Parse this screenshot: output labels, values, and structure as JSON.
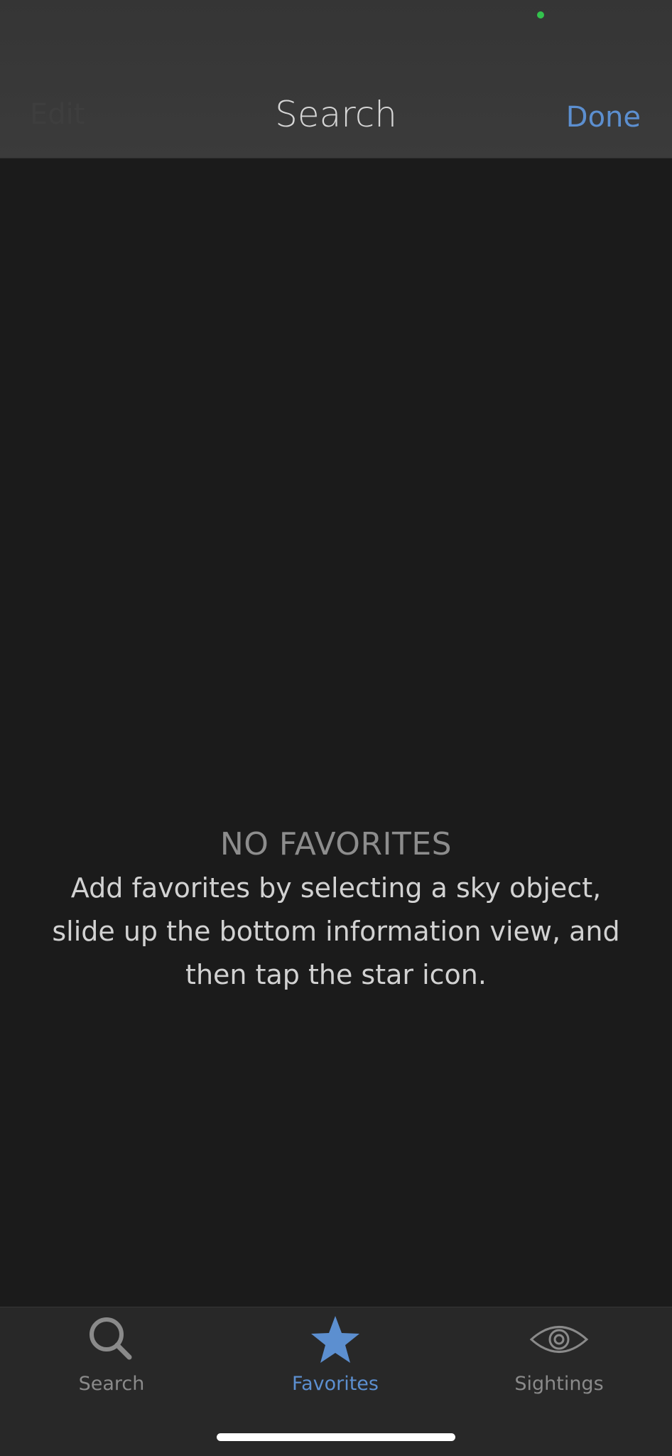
{
  "nav": {
    "edit_label": "Edit",
    "title": "Search",
    "done_label": "Done"
  },
  "empty_state": {
    "title": "NO FAVORITES",
    "message": "Add favorites by selecting a sky object, slide up the bottom information view, and then tap the star icon."
  },
  "tabs": [
    {
      "label": "Search",
      "icon": "search-icon",
      "active": false
    },
    {
      "label": "Favorites",
      "icon": "star-icon",
      "active": true
    },
    {
      "label": "Sightings",
      "icon": "eye-icon",
      "active": false
    }
  ],
  "colors": {
    "accent": "#5c8fd0",
    "background": "#1b1b1b",
    "status_dot": "#33c24d"
  }
}
